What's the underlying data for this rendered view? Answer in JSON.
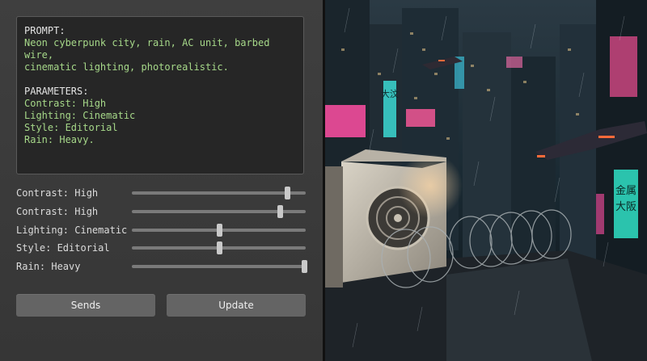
{
  "prompt": {
    "heading": "PROMPT:",
    "line1": "Neon cyberpunk city, rain, AC unit, barbed wire,",
    "line2": "cinematic lighting, photorealistic.",
    "params_heading": "PARAMETERS:",
    "params": [
      "Contrast: High",
      "Lighting: Cinematic",
      "Style: Editorial",
      "Rain: Heavy."
    ]
  },
  "sliders": [
    {
      "label": "Contrast: High",
      "value": 0.9
    },
    {
      "label": "Contrast: High",
      "value": 0.86
    },
    {
      "label": "Lighting: Cinematic",
      "value": 0.5
    },
    {
      "label": "Style: Editorial",
      "value": 0.5
    },
    {
      "label": "Rain: Heavy",
      "value": 1.0
    }
  ],
  "buttons": {
    "sends": "Sends",
    "update": "Update"
  },
  "scene": {
    "signs": [
      "金属",
      "大阪",
      "大汶"
    ],
    "colors": {
      "neon_pink": "#ff4fa3",
      "neon_cyan": "#3ff0e8",
      "sky": "#1b2a33"
    }
  }
}
